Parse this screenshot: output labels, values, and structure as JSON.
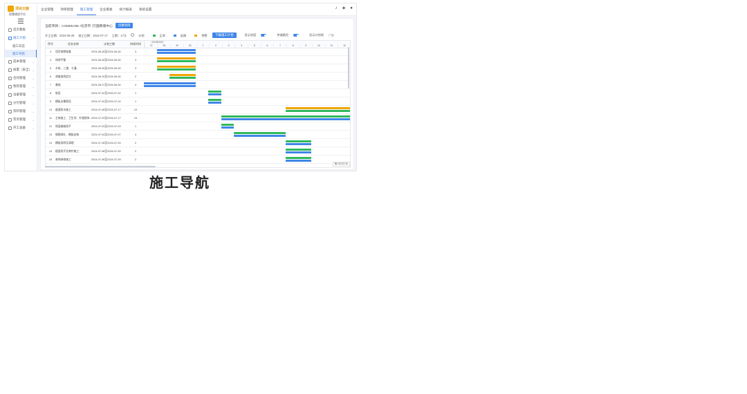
{
  "logo": {
    "mark": "",
    "name": "项目云脑",
    "subtitle": "智慧建造平台"
  },
  "sidebar": {
    "items": [
      {
        "label": "首页看板",
        "open": false
      },
      {
        "label": "施工计划",
        "open": true
      },
      {
        "label": "成本管理",
        "open": false
      },
      {
        "label": "质量（安全）",
        "open": false
      },
      {
        "label": "合同管理",
        "open": false
      },
      {
        "label": "物资管理",
        "open": false
      },
      {
        "label": "设备管理",
        "open": false
      },
      {
        "label": "分包管理",
        "open": false
      },
      {
        "label": "资料管理",
        "open": false
      },
      {
        "label": "劳务管理",
        "open": false
      },
      {
        "label": "开工准备",
        "open": false
      }
    ],
    "submenu_open_index": 1,
    "submenus": [
      {
        "label": "施工日志",
        "active": false
      },
      {
        "label": "施工导航",
        "active": true
      }
    ]
  },
  "topbar": {
    "tabs": [
      {
        "label": "企业管理",
        "active": false
      },
      {
        "label": "项目管理",
        "active": false
      },
      {
        "label": "施工管理",
        "active": true
      },
      {
        "label": "企业看板",
        "active": false
      },
      {
        "label": "统计报表",
        "active": false
      },
      {
        "label": "系统设置",
        "active": false
      }
    ],
    "icons": [
      "bell-icon",
      "fullscreen-icon",
      "user-icon"
    ]
  },
  "selector": {
    "text": "当前项目：COMMUNE /北京市 /万国商城中心",
    "button": "切换项目"
  },
  "info": {
    "start": "开工日期：2024-06-28",
    "end": "竣工日期：2024-07-17",
    "duration": "工期：17天",
    "radio": "计划",
    "legend": [
      {
        "label": "正常",
        "color": "#2fb85c"
      },
      {
        "label": "延期",
        "color": "#3f86e8"
      },
      {
        "label": "预警",
        "color": "#f0a500"
      }
    ],
    "button": "下载施工计划",
    "toggles": [
      {
        "label": "显示进度",
        "on": true
      },
      {
        "label": "关键路径",
        "on": true
      },
      {
        "label": "显示计划线",
        "on": false
      }
    ]
  },
  "grid": {
    "headers": {
      "index": "序号",
      "name": "任务名称",
      "plan": "计划工期",
      "days": "持续时间"
    },
    "month_label": "2024年06月",
    "dates": [
      "27",
      "28",
      "29",
      "30",
      "1",
      "2",
      "3",
      "4",
      "5",
      "6",
      "7",
      "8",
      "9",
      "10",
      "11",
      "12"
    ],
    "rows": [
      {
        "index": "3",
        "name": "项目前期准备",
        "plan": "2024-06-28至2024-06-30",
        "days": "3"
      },
      {
        "index": "4",
        "name": "场地平整",
        "plan": "2024-06-28至2024-06-30",
        "days": "3"
      },
      {
        "index": "5",
        "name": "水电、三通、七通...",
        "plan": "2024-06-28至2024-06-30",
        "days": "3"
      },
      {
        "index": "6",
        "name": "测量放线定位",
        "plan": "2024-06-29至2024-06-30",
        "days": "2"
      },
      {
        "index": "7",
        "name": "基础",
        "plan": "2024-06-27至2024-06-30",
        "days": "4"
      },
      {
        "index": "8",
        "name": "垫层",
        "plan": "2024-07-02至2024-07-02",
        "days": "1"
      },
      {
        "index": "9",
        "name": "模板支撑搭设",
        "plan": "2024-07-02至2024-07-02",
        "days": "1"
      },
      {
        "index": "10",
        "name": "屋面防水施工",
        "plan": "2024-07-08至2024-07-17",
        "days": "10"
      },
      {
        "index": "11",
        "name": "主体施工、卫生间、外墙装饰...",
        "plan": "2024-07-03至2024-07-17",
        "days": "15"
      },
      {
        "index": "12",
        "name": "地面基础找平",
        "plan": "2024-07-03至2024-07-03",
        "days": "1"
      },
      {
        "index": "13",
        "name": "钢筋绑扎、模板安装",
        "plan": "2024-07-04至2024-07-07",
        "days": "4"
      },
      {
        "index": "14",
        "name": "模板拆除及清理",
        "plan": "2024-07-08至2024-07-09",
        "days": "2"
      },
      {
        "index": "15",
        "name": "楼面找平及养护施工",
        "plan": "2024-07-08至2024-07-09",
        "days": "2"
      },
      {
        "index": "16",
        "name": "装饰装修施工",
        "plan": "2024-07-08至2024-07-09",
        "days": "2"
      }
    ],
    "pager": "第1页/共2页"
  },
  "caption": "施工导航"
}
